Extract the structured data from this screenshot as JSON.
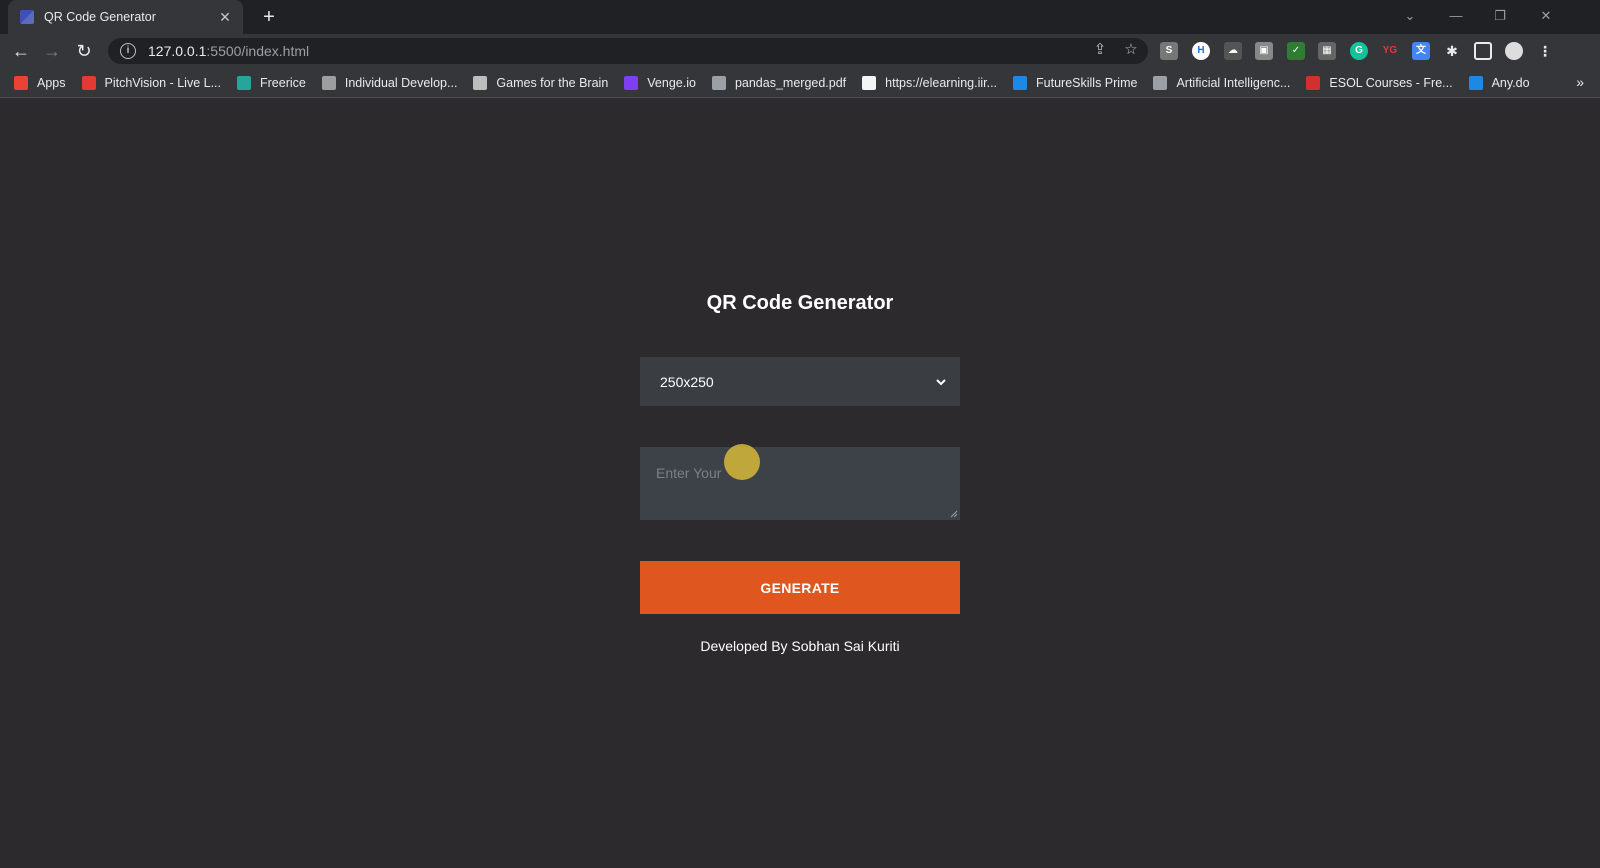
{
  "browser": {
    "tab_title": "QR Code Generator",
    "new_tab_symbol": "+",
    "url_host": "127.0.0.1",
    "url_path": ":5500/index.html",
    "bookmarks": [
      {
        "label": "Apps",
        "color": "#ea4335"
      },
      {
        "label": "PitchVision - Live L...",
        "color": "#e53935"
      },
      {
        "label": "Freerice",
        "color": "#26a69a"
      },
      {
        "label": "Individual Develop...",
        "color": "#9e9e9e"
      },
      {
        "label": "Games for the Brain",
        "color": "#bdbdbd"
      },
      {
        "label": "Venge.io",
        "color": "#7e3ff2"
      },
      {
        "label": "pandas_merged.pdf",
        "color": "#9aa0a6"
      },
      {
        "label": "https://elearning.iir...",
        "color": "#f5f5f5"
      },
      {
        "label": "FutureSkills Prime",
        "color": "#1e88e5"
      },
      {
        "label": "Artificial Intelligenc...",
        "color": "#9aa0a6"
      },
      {
        "label": "ESOL Courses - Fre...",
        "color": "#d32f2f"
      },
      {
        "label": "Any.do",
        "color": "#1e88e5"
      }
    ]
  },
  "app": {
    "title": "QR Code Generator",
    "size_select_value": "250x250",
    "text_placeholder": "Enter Your",
    "generate_label": "GENERATE",
    "credit": "Developed By Sobhan Sai Kuriti"
  },
  "colors": {
    "page_bg": "#2d2a2e",
    "accent": "#e0561f",
    "input_bg": "#3d4249"
  }
}
